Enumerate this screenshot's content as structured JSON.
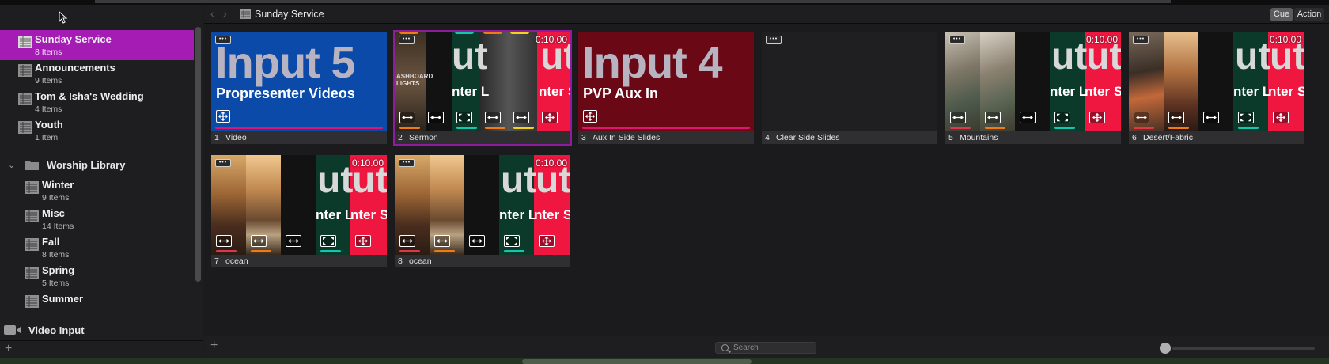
{
  "colors": {
    "accent_selection": "#a51cb5",
    "blue_slide": "#0b4aa8",
    "red_slide": "#6a0816",
    "pink_line": "#e01570",
    "green_panel": "#0b3a2a",
    "red_panel": "#ef1640",
    "teal_bar": "#13c6b0",
    "orange_bar": "#f07a14",
    "yellow_bar": "#f3d11c"
  },
  "sidebar": {
    "items": [
      {
        "title": "Sunday Service",
        "subtitle": "8 Items",
        "icon": "playlist-icon",
        "active": true
      },
      {
        "title": "Announcements",
        "subtitle": "9 Items",
        "icon": "playlist-icon"
      },
      {
        "title": "Tom & Isha's Wedding",
        "subtitle": "4 Items",
        "icon": "playlist-icon"
      },
      {
        "title": "Youth",
        "subtitle": "1 Item",
        "icon": "playlist-icon"
      }
    ],
    "folder": {
      "title": "Worship Library",
      "expanded": true,
      "icon": "folder-icon"
    },
    "folder_items": [
      {
        "title": "Winter",
        "subtitle": "9 Items"
      },
      {
        "title": "Misc",
        "subtitle": "14 Items"
      },
      {
        "title": "Fall",
        "subtitle": "8 Items"
      },
      {
        "title": "Spring",
        "subtitle": "5 Items"
      },
      {
        "title": "Summer",
        "subtitle": ""
      }
    ],
    "video_input": "Video Input",
    "add_symbol": "+"
  },
  "toolbar": {
    "back": "‹",
    "forward": "›",
    "title": "Sunday Service",
    "cue_label": "Cue",
    "action_label": "Action"
  },
  "cues": [
    {
      "num": "1",
      "label": "Video",
      "big": "Input 5",
      "sub": "Propresenter Videos"
    },
    {
      "num": "2",
      "label": "Sermon",
      "timer": "0:10.00",
      "side_text": "ASHBOARD LIGHTS"
    },
    {
      "num": "3",
      "label": "Aux In Side Slides",
      "big": "Input 4",
      "sub": "PVP Aux In"
    },
    {
      "num": "4",
      "label": "Clear Side Slides"
    },
    {
      "num": "5",
      "label": "Mountains",
      "timer": "0:10.00"
    },
    {
      "num": "6",
      "label": "Desert/Fabric",
      "timer": "0:10.00"
    },
    {
      "num": "7",
      "label": "ocean",
      "timer": "0:10.00"
    },
    {
      "num": "8",
      "label": "ocean",
      "timer": "0:10.00"
    }
  ],
  "lower_third": {
    "a": "ut",
    "b": "ut",
    "c": "nter L",
    "d": "nter S"
  },
  "footer": {
    "add_symbol": "+",
    "search_placeholder": "Search",
    "zoom_level": 0.0
  }
}
